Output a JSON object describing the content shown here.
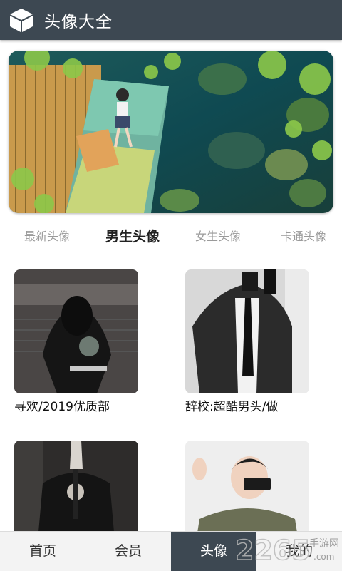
{
  "header": {
    "title": "头像大全",
    "icon": "cube-icon",
    "background": "#3d4852"
  },
  "category_tabs": [
    {
      "label": "最新头像",
      "active": false
    },
    {
      "label": "男生头像",
      "active": true
    },
    {
      "label": "女生头像",
      "active": false
    },
    {
      "label": "卡通头像",
      "active": false
    }
  ],
  "albums": [
    {
      "title": "寻欢/2019优质部"
    },
    {
      "title": "辞校:超酷男头/做"
    },
    {
      "title": ""
    },
    {
      "title": ""
    }
  ],
  "bottom_nav": [
    {
      "label": "首页",
      "active": false
    },
    {
      "label": "会员",
      "active": false
    },
    {
      "label": "头像",
      "active": true
    },
    {
      "label": "我的",
      "active": false
    }
  ],
  "watermark": {
    "number": "2265",
    "text": "手游网",
    "url": ".com"
  },
  "colors": {
    "nav_active": "#3d4852",
    "tab_active": "#222222",
    "tab_inactive": "#9a9a9a"
  }
}
